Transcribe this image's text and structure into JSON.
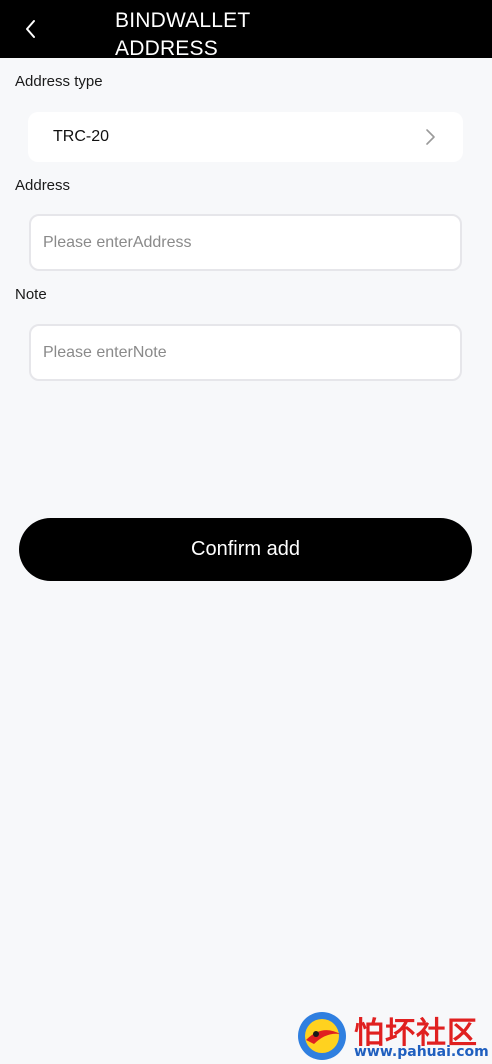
{
  "header": {
    "title": "BINDWALLET\nADDRESS",
    "back_icon": "chevron-left-icon"
  },
  "address_type": {
    "label": "Address type",
    "value": "TRC-20",
    "icon": "chevron-right-icon"
  },
  "address": {
    "label": "Address",
    "placeholder": "Please enterAddress",
    "value": ""
  },
  "note": {
    "label": "Note",
    "placeholder": "Please enterNote",
    "value": ""
  },
  "confirm_label": "Confirm add",
  "watermark": {
    "text": "怕坏社区",
    "url": "www.pahuai.com"
  },
  "colors": {
    "header_bg": "#000000",
    "page_bg": "#f7f8fa",
    "button_bg": "#000000",
    "watermark_red": "#e02020",
    "watermark_blue": "#1f5fbf"
  }
}
